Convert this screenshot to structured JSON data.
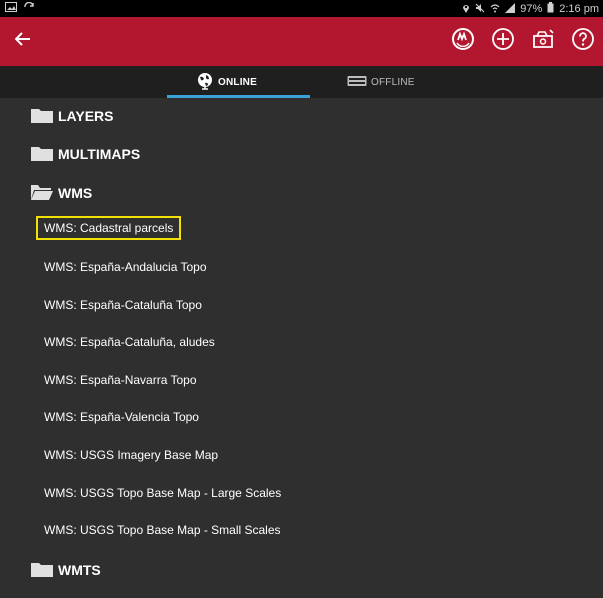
{
  "status_bar": {
    "left_icons": [
      "image-icon",
      "sync-icon"
    ],
    "right_icons": [
      "location-icon",
      "mute-icon",
      "wifi-icon",
      "signal-icon",
      "battery-icon"
    ],
    "battery": "97%",
    "time": "2:16 pm"
  },
  "app_bar": {
    "color": "#b3172f",
    "icons": [
      "back-arrow-icon",
      "layers-sync-icon",
      "add-circle-icon",
      "map-settings-icon",
      "help-icon"
    ]
  },
  "tabs": [
    {
      "label": "ONLINE",
      "selected": true,
      "icon": "globe-icon"
    },
    {
      "label": "OFFLINE",
      "selected": false,
      "icon": "storage-icon"
    }
  ],
  "folders": {
    "layers": "LAYERS",
    "multimaps": "MULTIMAPS",
    "wms": "WMS",
    "wmts": "WMTS"
  },
  "wms_items": [
    "WMS: Cadastral parcels",
    "WMS: España-Andalucia Topo",
    "WMS: España-Cataluña Topo",
    "WMS: España-Cataluña, aludes",
    "WMS: España-Navarra Topo",
    "WMS: España-Valencia Topo",
    "WMS: USGS Imagery Base Map",
    "WMS: USGS Topo Base Map - Large Scales",
    "WMS: USGS Topo Base Map - Small Scales"
  ],
  "selected_item_index": 0,
  "highlight_color": "#f1e000"
}
